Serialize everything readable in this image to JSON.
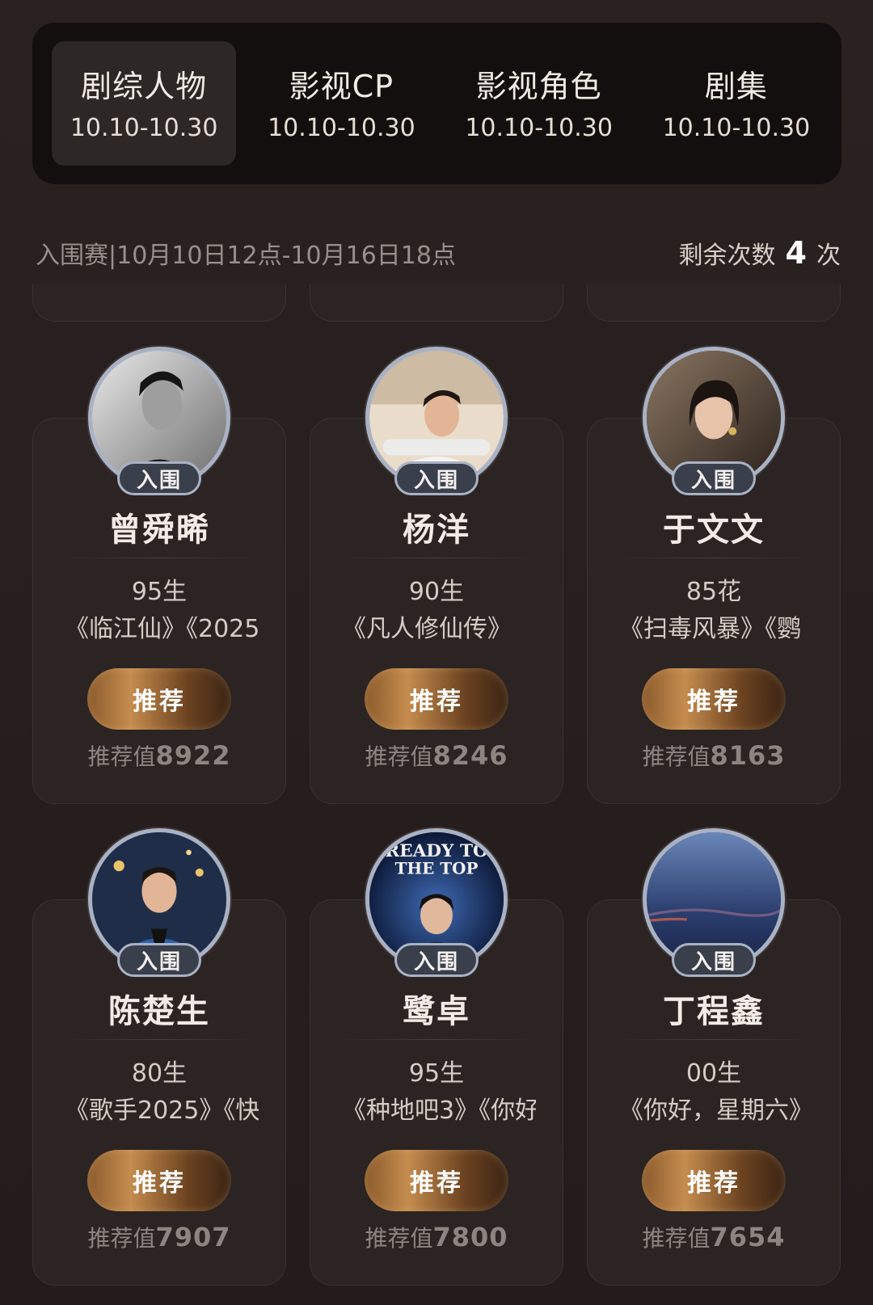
{
  "tabs": [
    {
      "title": "剧综人物",
      "date": "10.10-10.30",
      "active": true
    },
    {
      "title": "影视CP",
      "date": "10.10-10.30",
      "active": false
    },
    {
      "title": "影视角色",
      "date": "10.10-10.30",
      "active": false
    },
    {
      "title": "剧集",
      "date": "10.10-10.30",
      "active": false
    }
  ],
  "round": {
    "text": "入围赛|10月10日12点-10月16日18点",
    "remain_label": "剩余次数",
    "remain_count": "4",
    "remain_unit": "次"
  },
  "badge_label": "入围",
  "button_label": "推荐",
  "score_label": "推荐值",
  "cards": [
    {
      "name": "曾舜晞",
      "tag": "95生",
      "works": "《临江仙》《2025",
      "score": "8922",
      "avatar": "man-bw-portrait"
    },
    {
      "name": "杨洋",
      "tag": "90生",
      "works": "《凡人修仙传》",
      "score": "8246",
      "avatar": "man-white-shirt"
    },
    {
      "name": "于文文",
      "tag": "85花",
      "works": "《扫毒风暴》《鹦",
      "score": "8163",
      "avatar": "woman-portrait"
    },
    {
      "name": "陈楚生",
      "tag": "80生",
      "works": "《歌手2025》《快",
      "score": "7907",
      "avatar": "man-blue-suit"
    },
    {
      "name": "鹭卓",
      "tag": "95生",
      "works": "《种地吧3》《你好",
      "score": "7800",
      "avatar": "man-concert-poster"
    },
    {
      "name": "丁程鑫",
      "tag": "00生",
      "works": "《你好，星期六》",
      "score": "7654",
      "avatar": "blue-sky"
    }
  ]
}
